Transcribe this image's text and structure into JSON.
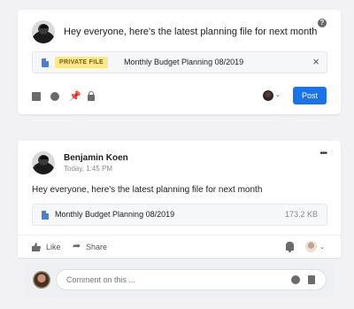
{
  "composer": {
    "text": "Hey everyone, here's the latest planning file for next month",
    "help_icon": "?",
    "attachment": {
      "badge": "PRIVATE FILE",
      "name": "Monthly Budget Planning 08/2019",
      "remove_icon": "×"
    },
    "toolbar": {
      "icons": [
        "document-icon",
        "emoji-icon",
        "pin-icon",
        "lock-icon"
      ]
    },
    "audience_chevron": "⌄",
    "post_label": "Post"
  },
  "post": {
    "author": "Benjamin Koen",
    "timestamp": "Today, 1:45 PM",
    "more_icon": "•••",
    "text": "Hey everyone, here's the latest planning file for next month",
    "file": {
      "name": "Monthly Budget Planning 08/2019",
      "size": "173.2 KB"
    },
    "actions": {
      "like_label": "Like",
      "share_label": "Share",
      "share_icon": "➦"
    },
    "audience_chevron": "⌄"
  },
  "comment": {
    "placeholder": "Comment on this ..."
  },
  "colors": {
    "accent": "#1a73e8",
    "private_badge_bg": "#fbe78c",
    "background": "#f2f2f4"
  }
}
